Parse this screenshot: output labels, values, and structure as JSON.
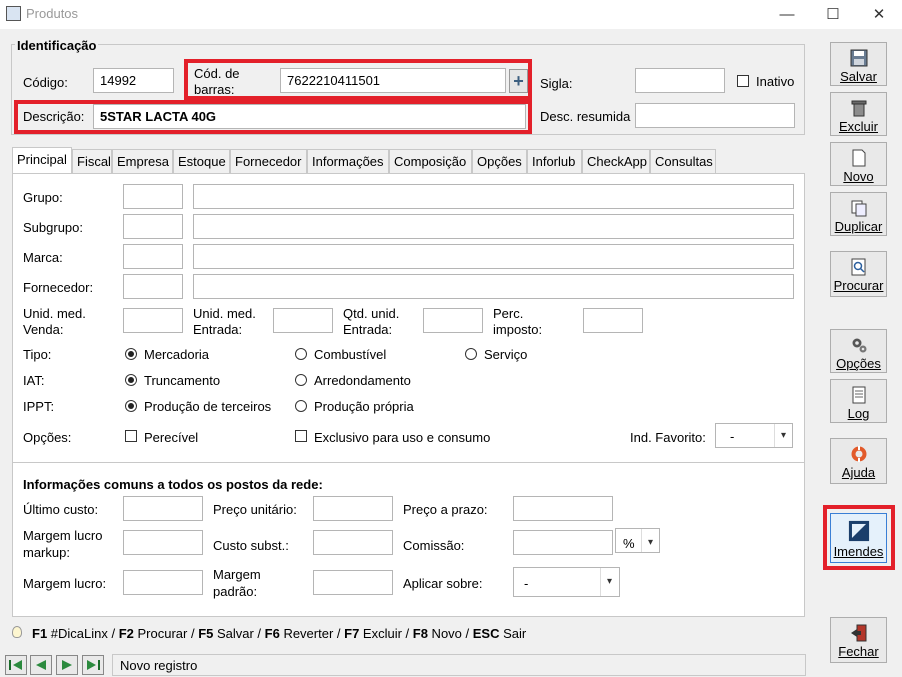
{
  "window": {
    "title": "Produtos",
    "minimize": "—",
    "maximize": "☐",
    "close": "✕"
  },
  "identificacao": {
    "title": "Identificação",
    "codigo_label": "Código:",
    "codigo_value": "14992",
    "barcode_label_1": "Cód. de",
    "barcode_label_2": "barras:",
    "barcode_value": "7622210411501",
    "sigla_label": "Sigla:",
    "sigla_value": "",
    "inativo_label": "Inativo",
    "descricao_label": "Descrição:",
    "descricao_value": "5STAR LACTA 40G",
    "desc_resumida_label": "Desc. resumida",
    "desc_resumida_value": ""
  },
  "tabs": [
    "Principal",
    "Fiscal",
    "Empresa",
    "Estoque",
    "Fornecedor",
    "Informações",
    "Composição",
    "Opções",
    "Inforlub",
    "CheckApp",
    "Consultas"
  ],
  "principal": {
    "grupo_label": "Grupo:",
    "subgrupo_label": "Subgrupo:",
    "marca_label": "Marca:",
    "fornecedor_label": "Fornecedor:",
    "unid_venda_1": "Unid. med.",
    "unid_venda_2": "Venda:",
    "unid_entrada_1": "Unid. med.",
    "unid_entrada_2": "Entrada:",
    "qtd_entrada_1": "Qtd. unid.",
    "qtd_entrada_2": "Entrada:",
    "perc_imposto_1": "Perc.",
    "perc_imposto_2": "imposto:",
    "tipo_label": "Tipo:",
    "tipo_options": [
      "Mercadoria",
      "Combustível",
      "Serviço"
    ],
    "iat_label": "IAT:",
    "iat_options": [
      "Truncamento",
      "Arredondamento"
    ],
    "ippt_label": "IPPT:",
    "ippt_options": [
      "Produção de terceiros",
      "Produção própria"
    ],
    "opcoes_label": "Opções:",
    "perecivel_label": "Perecível",
    "exclusivo_label": "Exclusivo para uso e consumo",
    "ind_favorito_label": "Ind. Favorito:",
    "ind_favorito_value": "-"
  },
  "comuns": {
    "title": "Informações comuns a todos os postos da rede:",
    "ultimo_custo": "Último custo:",
    "preco_unitario": "Preço unitário:",
    "preco_prazo": "Preço a prazo:",
    "margem_markup_1": "Margem lucro",
    "margem_markup_2": "markup:",
    "custo_subst": "Custo subst.:",
    "comissao": "Comissão:",
    "comissao_unit": "%",
    "margem_lucro": "Margem lucro:",
    "margem_padrao_1": "Margem",
    "margem_padrao_2": "padrão:",
    "aplicar_sobre": "Aplicar sobre:",
    "aplicar_sobre_value": "-"
  },
  "shortcuts": [
    {
      "key": "F1",
      "text": " #DicaLinx / "
    },
    {
      "key": "F2",
      "text": " Procurar / "
    },
    {
      "key": "F5",
      "text": " Salvar / "
    },
    {
      "key": "F6",
      "text": " Reverter / "
    },
    {
      "key": "F7",
      "text": " Excluir / "
    },
    {
      "key": "F8",
      "text": " Novo / "
    },
    {
      "key": "ESC",
      "text": " Sair"
    }
  ],
  "status": {
    "text": "Novo registro"
  },
  "sidebar": {
    "salvar": "Salvar",
    "excluir": "Excluir",
    "novo": "Novo",
    "duplicar": "Duplicar",
    "procurar": "Procurar",
    "opcoes": "Opções",
    "log": "Log",
    "ajuda": "Ajuda",
    "imendes": "Imendes",
    "fechar": "Fechar"
  },
  "colors": {
    "highlight": "#e3202a",
    "accent": "#3a7fd5"
  }
}
